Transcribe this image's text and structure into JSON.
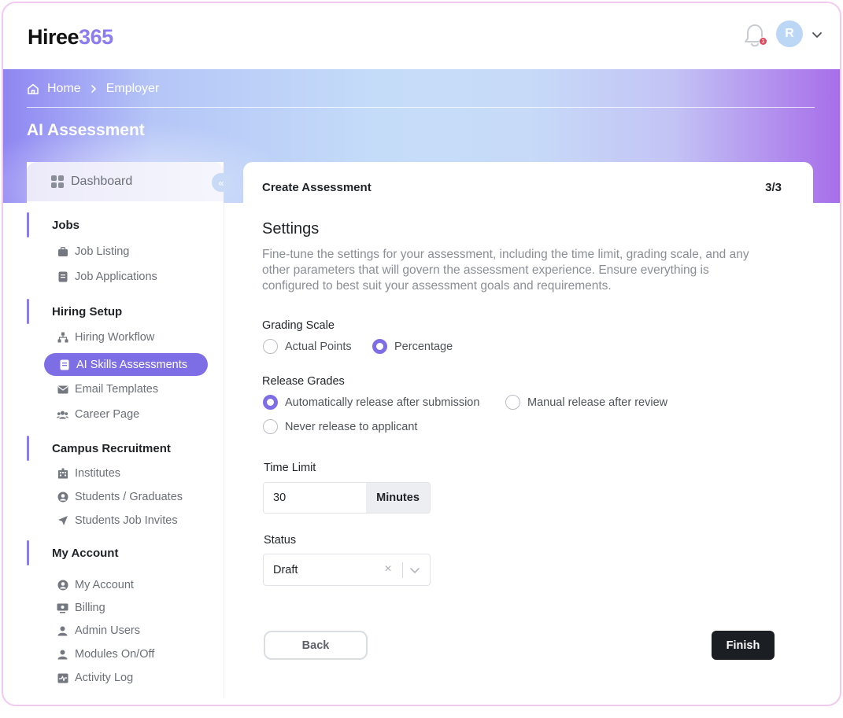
{
  "brand": {
    "logo_text": "Hiree",
    "logo_num": "365"
  },
  "topbar": {
    "notification_count": "3",
    "avatar_initial": "R"
  },
  "breadcrumb": {
    "home": "Home",
    "current": "Employer"
  },
  "page": {
    "title": "AI Assessment"
  },
  "sidebar": {
    "dashboard": "Dashboard",
    "sections": {
      "jobs": {
        "title": "Jobs",
        "items": [
          "Job Listing",
          "Job Applications"
        ]
      },
      "hiring": {
        "title": "Hiring Setup",
        "items": [
          "Hiring Workflow",
          "AI Skills Assessments",
          "Email Templates",
          "Career Page"
        ]
      },
      "campus": {
        "title": "Campus Recruitment",
        "items": [
          "Institutes",
          "Students / Graduates",
          "Students Job Invites"
        ]
      },
      "account": {
        "title": "My Account",
        "items": [
          "My Account",
          "Billing",
          "Admin Users",
          "Modules On/Off",
          "Activity Log"
        ]
      }
    },
    "active_item": "AI Skills Assessments"
  },
  "card": {
    "header": "Create Assessment",
    "step": "3/3",
    "title": "Settings",
    "description": "Fine-tune the settings for your assessment, including the time limit, grading scale, and any other parameters that will govern the assessment experience. Ensure everything is configured to best suit your assessment goals and requirements.",
    "grading": {
      "label": "Grading Scale",
      "options": [
        "Actual Points",
        "Percentage"
      ],
      "selected": "Percentage"
    },
    "release": {
      "label": "Release Grades",
      "options": [
        "Automatically release after submission",
        "Manual release after review",
        "Never release to applicant"
      ],
      "selected": "Automatically release after submission"
    },
    "time_limit": {
      "label": "Time Limit",
      "value": "30",
      "unit": "Minutes"
    },
    "status": {
      "label": "Status",
      "value": "Draft"
    },
    "buttons": {
      "back": "Back",
      "finish": "Finish"
    }
  },
  "colors": {
    "accent": "#7d6ee6",
    "finish_bg": "#1b1f23",
    "frame_border": "#f1c9ee"
  }
}
